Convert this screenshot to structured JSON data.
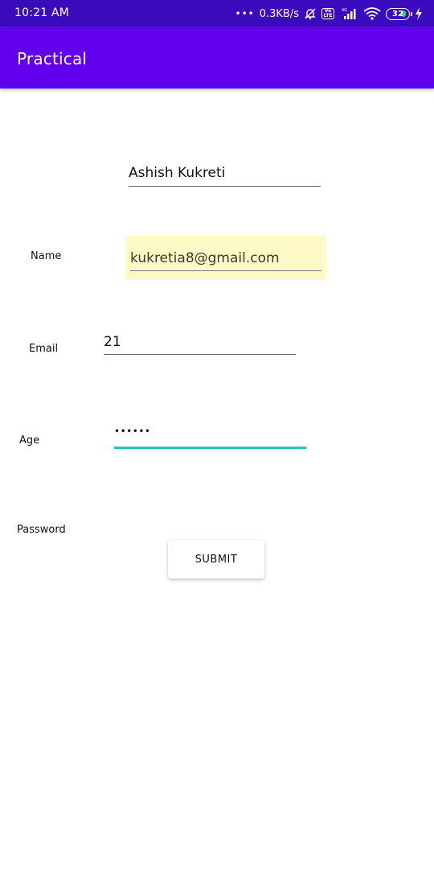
{
  "status_bar": {
    "time": "10:21 AM",
    "network_speed": "0.3KB/s",
    "battery_level": "32",
    "icons": [
      "more-dots-icon",
      "alarm-off-icon",
      "volte-icon",
      "signal-4g-icon",
      "wifi-icon",
      "battery-icon",
      "charging-bolt-icon"
    ]
  },
  "app_bar": {
    "title": "Practical",
    "color": "#6200ee"
  },
  "form": {
    "labels": {
      "name": "Name",
      "email": "Email",
      "age": "Age",
      "password": "Password"
    },
    "fields": {
      "name_value": "Ashish Kukreti",
      "email_value": "kukretia8@gmail.com",
      "age_value": "21",
      "password_value": "••••••"
    },
    "submit_label": "SUBMIT",
    "colors": {
      "autofill_highlight": "#fefac8",
      "focused_underline": "#22c5bb"
    }
  }
}
